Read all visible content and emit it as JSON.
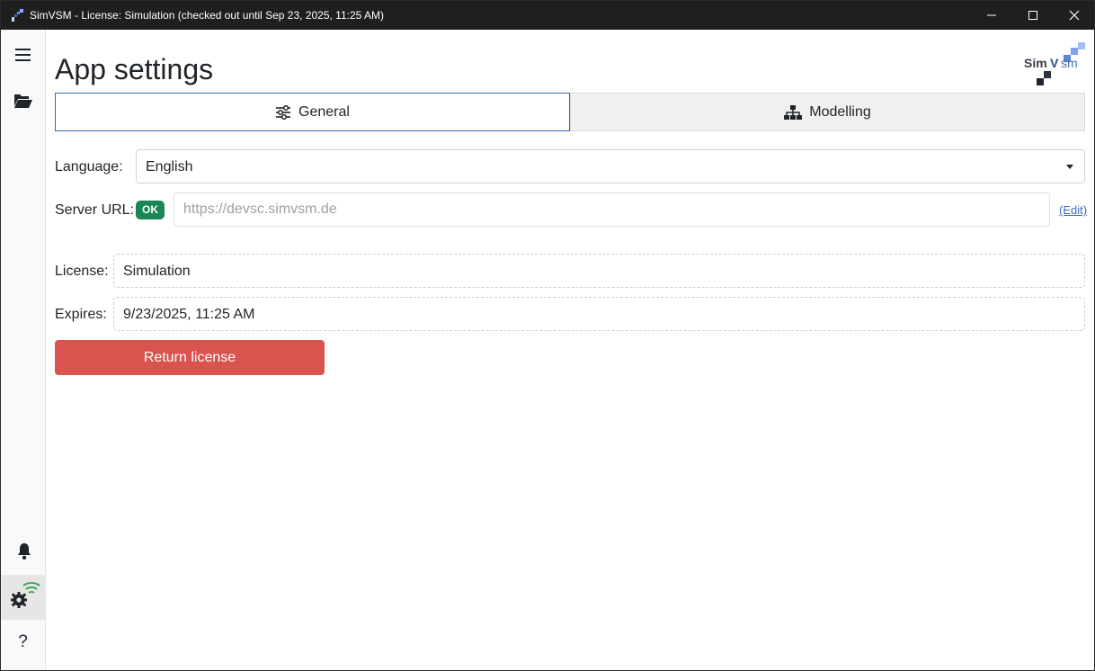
{
  "window": {
    "title": "SimVSM - License: Simulation (checked out until Sep 23, 2025, 11:25 AM)"
  },
  "sidebar": {
    "items": [
      {
        "name": "menu",
        "icon": "hamburger-icon"
      },
      {
        "name": "open",
        "icon": "folder-open-icon"
      },
      {
        "name": "notifications",
        "icon": "bell-icon"
      },
      {
        "name": "settings",
        "icon": "gear-wifi-icon",
        "active": true
      },
      {
        "name": "help",
        "icon": "question-icon",
        "label": "?"
      }
    ]
  },
  "page": {
    "title": "App settings",
    "logo_text": "SimVsm"
  },
  "tabs": [
    {
      "label": "General",
      "icon": "sliders-icon",
      "active": true
    },
    {
      "label": "Modelling",
      "icon": "sitemap-icon",
      "active": false
    }
  ],
  "form": {
    "language": {
      "label": "Language:",
      "value": "English"
    },
    "server_url": {
      "label": "Server URL:",
      "status": "OK",
      "placeholder": "https://devsc.simvsm.de",
      "edit_label": "(Edit)"
    },
    "license": {
      "label": "License:",
      "value": "Simulation"
    },
    "expires": {
      "label": "Expires:",
      "value": "9/23/2025, 11:25 AM"
    },
    "return_button": "Return license"
  },
  "colors": {
    "titlebar": "#1f1f1f",
    "tab_active_border": "#3f69a8",
    "ok_badge": "#198754",
    "danger": "#d9534f",
    "link": "#3d6cc0",
    "wifi_icon": "#2ea043"
  }
}
